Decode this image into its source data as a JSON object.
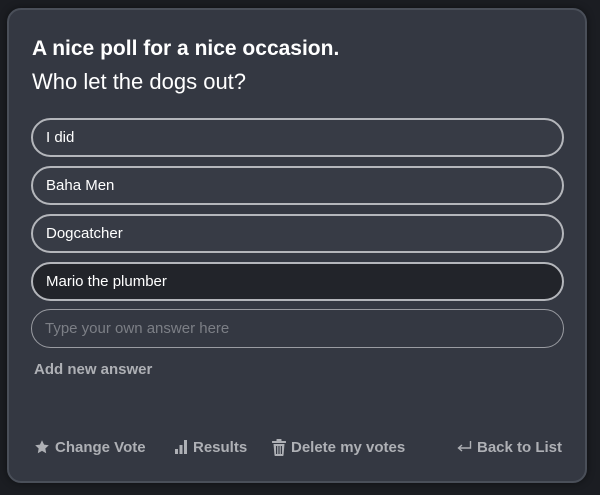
{
  "poll": {
    "title": "A nice poll for a nice occasion.",
    "question": "Who let the dogs out?",
    "answers": [
      {
        "label": "I did",
        "selected": false
      },
      {
        "label": "Baha Men",
        "selected": false
      },
      {
        "label": "Dogcatcher",
        "selected": false
      },
      {
        "label": "Mario the plumber",
        "selected": true
      }
    ],
    "own_answer": {
      "value": "",
      "placeholder": "Type your own answer here"
    },
    "add_answer_label": "Add new answer"
  },
  "footer": {
    "change_vote": {
      "label": "Change Vote",
      "icon": "star-icon"
    },
    "results": {
      "label": "Results",
      "icon": "bar-chart-icon"
    },
    "delete_votes": {
      "label": "Delete my votes",
      "icon": "trash-icon"
    },
    "back_to_list": {
      "label": "Back to List",
      "icon": "return-arrow-icon"
    }
  },
  "colors": {
    "page_background": "#1b1d22",
    "card_background": "#343842",
    "selected_answer_background": "#22242a",
    "answer_border": "#b4b6bb",
    "muted_text": "#aeb0b5",
    "primary_text": "#ffffff"
  }
}
